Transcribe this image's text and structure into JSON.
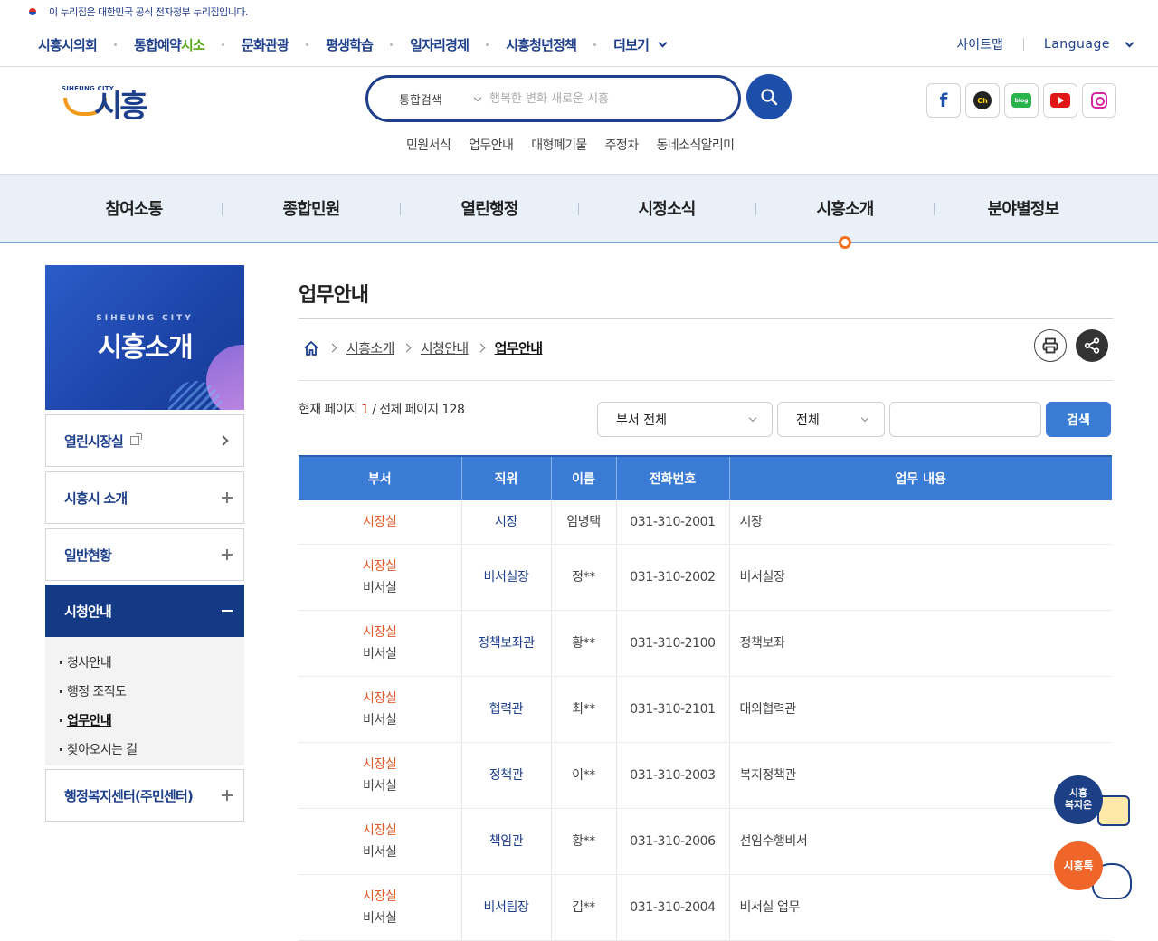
{
  "notice": {
    "text": "이 누리집은 대한민국 공식 전자정부 누리집입니다."
  },
  "topnav": {
    "items": [
      "시흥시의회",
      "통합예약",
      "문화관광",
      "평생학습",
      "일자리경제",
      "시흥청년정책",
      "더보기"
    ],
    "reserve_highlight": "시소",
    "sitemap": "사이트맵",
    "language": "Language"
  },
  "logo": {
    "en": "SIHEUNG CITY",
    "ko": "시흥"
  },
  "search": {
    "category": "통합검색",
    "placeholder": "행복한 변화 새로운 시흥"
  },
  "quicklinks": [
    "민원서식",
    "업무안내",
    "대형폐기물",
    "주정차",
    "동네소식알리미"
  ],
  "sns": {
    "ch": "Ch",
    "blog": "blog"
  },
  "gnb": [
    "참여소통",
    "종합민원",
    "열린행정",
    "시정소식",
    "시흥소개",
    "분야별정보"
  ],
  "side": {
    "banner_en": "SIHEUNG CITY",
    "banner_ko": "시흥소개",
    "items": [
      "열린시장실",
      "시흥시 소개",
      "일반현황",
      "시청안내",
      "행정복지센터(주민센터)"
    ],
    "sub_items": [
      "청사안내",
      "행정 조직도",
      "업무안내",
      "찾아오시는 길"
    ]
  },
  "main": {
    "title": "업무안내",
    "breadcrumb": [
      "시흥소개",
      "시청안내",
      "업무안내"
    ],
    "page_info": {
      "prefix": "현재 페이지",
      "current": "1",
      "mid": "/ 전체 페이지",
      "total": "128"
    },
    "filter": {
      "dept": "부서 전체",
      "field": "전체",
      "button": "검색"
    }
  },
  "table": {
    "headers": [
      "부서",
      "직위",
      "이름",
      "전화번호",
      "업무 내용"
    ],
    "rows": [
      {
        "dept": "시장실",
        "sub": "",
        "pos": "시장",
        "name": "임병택",
        "tel": "031-310-2001",
        "task": "시장"
      },
      {
        "dept": "시장실",
        "sub": "비서실",
        "pos": "비서실장",
        "name": "정**",
        "tel": "031-310-2002",
        "task": "비서실장"
      },
      {
        "dept": "시장실",
        "sub": "비서실",
        "pos": "정책보좌관",
        "name": "황**",
        "tel": "031-310-2100",
        "task": "정책보좌"
      },
      {
        "dept": "시장실",
        "sub": "비서실",
        "pos": "협력관",
        "name": "최**",
        "tel": "031-310-2101",
        "task": "대외협력관"
      },
      {
        "dept": "시장실",
        "sub": "비서실",
        "pos": "정책관",
        "name": "이**",
        "tel": "031-310-2003",
        "task": "복지정책관"
      },
      {
        "dept": "시장실",
        "sub": "비서실",
        "pos": "책임관",
        "name": "황**",
        "tel": "031-310-2006",
        "task": "선임수행비서"
      },
      {
        "dept": "시장실",
        "sub": "비서실",
        "pos": "비서팀장",
        "name": "김**",
        "tel": "031-310-2004",
        "task": "비서실 업무"
      }
    ]
  },
  "floating": {
    "welfare": "시흥\n복지온",
    "talk": "시흥톡"
  },
  "colors": {
    "primary": "#1e3f8a",
    "accent": "#3a7bd5",
    "orange": "#f37021",
    "red": "#d61f26"
  }
}
